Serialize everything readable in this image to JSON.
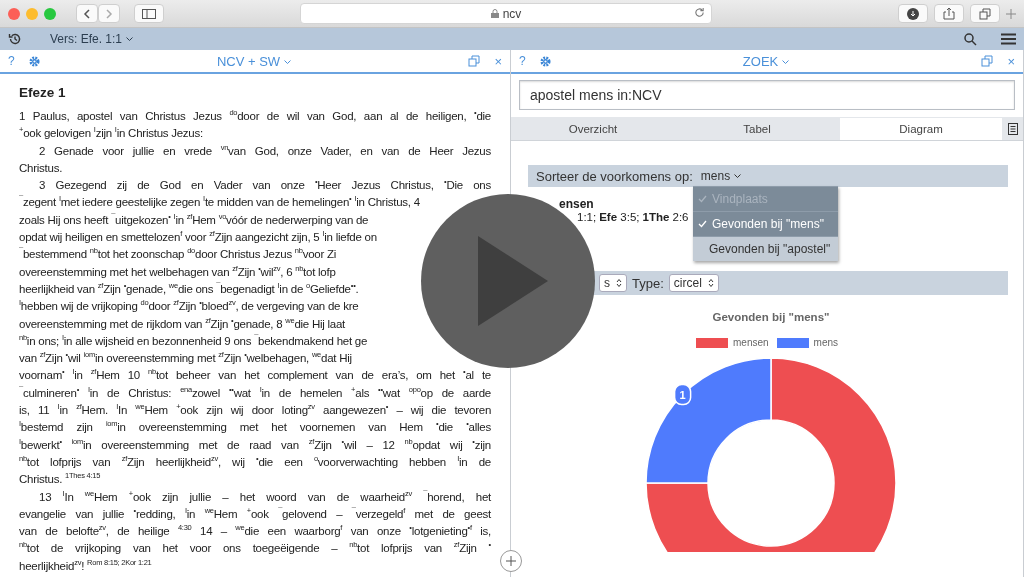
{
  "browser": {
    "address": "ncv"
  },
  "app_bar": {
    "verse_selector": "Vers: Efe. 1:1"
  },
  "left_pane": {
    "help": "?",
    "title": "NCV + SW",
    "close": "×",
    "heading": "Efeze 1",
    "lines": [
      {
        "text": "1 Paulus, apostel van Christus Jezus $^{do}$door de wil van God, aan al de heiligen, $^{•}$die",
        "kind": "full",
        "indent": false
      },
      {
        "text": "$^{+}$ook gelovigen $^{I}$zijn $^{I}$in Christus Jezus:",
        "kind": "end",
        "indent": false
      },
      {
        "text": "2 Genade voor jullie en vrede $^{vn}$van God, onze Vader, en van de Heer Jezus",
        "kind": "full",
        "indent": true
      },
      {
        "text": "Christus.",
        "kind": "end",
        "indent": false
      },
      {
        "text": "3 Gezegend zij de God en Vader van onze $^{•}$Heer Jezus Christus, $^{•}$Die ons",
        "kind": "full",
        "indent": true
      },
      {
        "text": "$^{¯}$zegent $^{I}$met iedere geestelijke zegen $^{I}$te midden van de hemelingen$^{•}$ $^{I}$in Christus, 4",
        "kind": "end",
        "indent": false
      },
      {
        "text": "zoals Hij ons heeft $^{¯}$uitgekozen$^{•}$ $^{I}$in $^{zf}$Hem $^{vo}$vóór de nederwerping van de",
        "kind": "end",
        "indent": false
      },
      {
        "text": "opdat wij heiligen en smettelozen$^{f}$ voor $^{zf}$Zijn aangezicht zijn, 5 $^{I}$in liefde on",
        "kind": "end",
        "indent": false
      },
      {
        "text": "$^{¯}$bestemmend $^{nb}$tot het zoonschap $^{do}$door Christus Jezus $^{nb}$voor Zi",
        "kind": "end",
        "indent": false
      },
      {
        "text": "overeenstemming met het welbehagen van $^{zf}$Zijn $^{•}$wil$^{zv}$, 6 $^{nb}$tot lofp",
        "kind": "end",
        "indent": false
      },
      {
        "text": "heerlijkheid van $^{zf}$Zijn $^{•}$genade, $^{we}$die ons $^{¯}$begenadigt $^{I}$in de $^{o}$Geliefde$^{••}$.",
        "kind": "end",
        "indent": false
      },
      {
        "text": "$^{I}$hebben wij de vrijkoping $^{do}$door $^{zf}$Zijn $^{•}$bloed$^{zv}$, de vergeving van de kre",
        "kind": "end",
        "indent": false
      },
      {
        "text": "overeenstemming met de rijkdom van $^{zf}$Zijn $^{•}$genade, 8 $^{we}$die Hij laat",
        "kind": "end",
        "indent": false
      },
      {
        "text": "$^{nb}$in ons; $^{I}$in alle wijsheid en bezonnenheid 9 ons $^{¯}$bekendmakend het ge",
        "kind": "end",
        "indent": false
      },
      {
        "text": "van $^{zf}$Zijn $^{•}$wil $^{iom}$in overeenstemming met $^{zf}$Zijn $^{•}$welbehagen, $^{we}$dat Hij",
        "kind": "end",
        "indent": false
      },
      {
        "text": "voornam$^{•}$ $^{I}$in $^{zf}$Hem 10 $^{nb}$tot beheer van het complement van de era’s, om het $^{•}$al te",
        "kind": "full",
        "indent": false
      },
      {
        "text": "$^{¯}$culmineren$^{•}$ $^{I}$in de Christus: $^{ena}$zowel $^{••}$wat $^{I}$in de hemelen $^{+}$als $^{••}$wat $^{opo}$op de aarde",
        "kind": "full",
        "indent": false
      },
      {
        "text": "is, 11 $^{I}$in $^{zf}$Hem. $^{I}$In $^{we}$Hem $^{+}$ook zijn wij door loting$^{zv}$ aangewezen$^{•}$ – wij die tevoren",
        "kind": "full",
        "indent": false
      },
      {
        "text": "$^{I}$bestemd zijn $^{iom}$in overeenstemming met het voornemen van Hem $^{•}$die $^{•}$alles",
        "kind": "full",
        "indent": false
      },
      {
        "text": "$^{I}$bewerkt$^{•}$ $^{iom}$in overeenstemming met de raad van $^{zf}$Zijn $^{•}$wil – 12 $^{nb}$opdat wij $^{•}$zijn",
        "kind": "full",
        "indent": false
      },
      {
        "text": "$^{nb}$tot lofprijs van $^{zf}$Zijn heerlijkheid$^{zv}$, wij $^{•}$die een $^{o}$voorverwachting hebben $^{I}$in de",
        "kind": "full",
        "indent": false
      },
      {
        "text": "Christus. $^{1Thes 4:15}$",
        "kind": "end",
        "indent": false
      },
      {
        "text": "13 $^{I}$In $^{we}$Hem $^{+}$ook zijn jullie – het woord van de waarheid$^{zv}$ $^{¯}$horend, het",
        "kind": "full",
        "indent": true
      },
      {
        "text": "evangelie van jullie $^{•}$redding, $^{I}$in $^{we}$Hem $^{+}$ook $^{¯}$gelovend – $^{¯}$verzegeld$^{f}$ met de geest",
        "kind": "full",
        "indent": false
      },
      {
        "text": "van de belofte$^{zv}$, de heilige $^{4:30}$ 14 – $^{we}$die een waarborg$^{f}$ van onze $^{•}$lotgenieting$^{•f}$ is,",
        "kind": "full",
        "indent": false
      },
      {
        "text": "$^{nb}$tot de vrijkoping van het voor ons toegeëigende – $^{nb}$tot lofprijs van $^{zf}$Zijn $^{•}$",
        "kind": "full",
        "indent": false
      },
      {
        "text": "heerlijkheid$^{zv}$! $^{Rom 8:15; 2Kor 1:21}$",
        "kind": "end",
        "indent": false
      }
    ]
  },
  "right_pane": {
    "help": "?",
    "title": "ZOEK",
    "close": "×",
    "search": {
      "value": "apostel mens in:NCV"
    },
    "tabs": [
      {
        "label": "Overzicht",
        "selected": false
      },
      {
        "label": "Tabel",
        "selected": false
      },
      {
        "label": "Diagram",
        "selected": true
      }
    ],
    "sort_bar": {
      "label": "Sorteer de voorkomens op:",
      "value": "mens"
    },
    "sort_menu": [
      {
        "label": "Vindplaats",
        "checked": true,
        "disabled": true,
        "selected": false
      },
      {
        "label": "Gevonden bij \"mens\"",
        "checked": true,
        "disabled": false,
        "selected": false
      },
      {
        "label": "Gevonden bij \"apostel\"",
        "checked": false,
        "disabled": false,
        "selected": true
      }
    ],
    "result": {
      "word": "ensen",
      "refs": [
        {
          "ref": "1:1;"
        },
        {
          "book": "Efe",
          "ref": "3:5;"
        },
        {
          "book": "1The",
          "ref": "2:6"
        }
      ]
    },
    "type_bar": {
      "first_select": "s",
      "type_label": "Type:",
      "type_value": "circel"
    },
    "chart_data": {
      "type": "donut",
      "title": "Gevonden bij \"mens\"",
      "categories": [
        "mensen",
        "mens"
      ],
      "values": [
        3,
        1
      ],
      "colors": [
        "#ee4e51",
        "#4f7bfd"
      ],
      "value_labels": [
        null,
        "1"
      ],
      "legend": true
    }
  }
}
